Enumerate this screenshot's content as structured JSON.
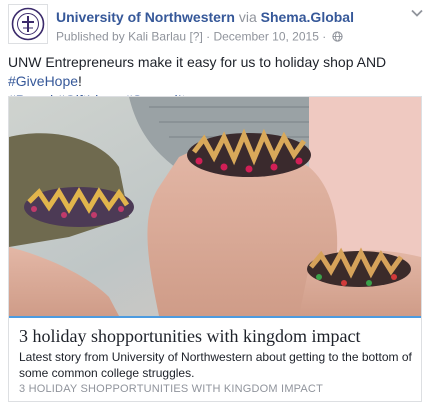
{
  "post": {
    "page_name": "University of Northwestern",
    "via_text": "via",
    "via_name": "Shema.Global",
    "published_prefix": "Published by",
    "author": "Kali Barlau",
    "help_marker": "[?]",
    "separator": "·",
    "date": "December 10, 2015",
    "privacy_icon": "globe-icon",
    "menu_icon": "chevron-down-icon"
  },
  "message": {
    "text_before": "UNW Entrepreneurs make it easy for us to holiday shop AND",
    "hashtag_1": "#GiveHope",
    "text_after_1": "!",
    "hashtag_2": "#Proud",
    "hashtag_3": "#GiftIdeas",
    "hashtag_4": "#SpreadIt"
  },
  "attachment": {
    "image_alt": "Three people's wrists wearing beaded bracelets",
    "title": "3 holiday shopportunities with kingdom impact",
    "description": "Latest story from University of Northwestern about getting to the bottom of some common college struggles.",
    "caption": "3 HOLIDAY SHOPPORTUNITIES WITH KINGDOM IMPACT",
    "load_progress": 1.0
  },
  "colors": {
    "link": "#365899",
    "meta": "#90949c",
    "text": "#1d2129",
    "border": "#dddfe2",
    "progress": "#4c9be0"
  }
}
